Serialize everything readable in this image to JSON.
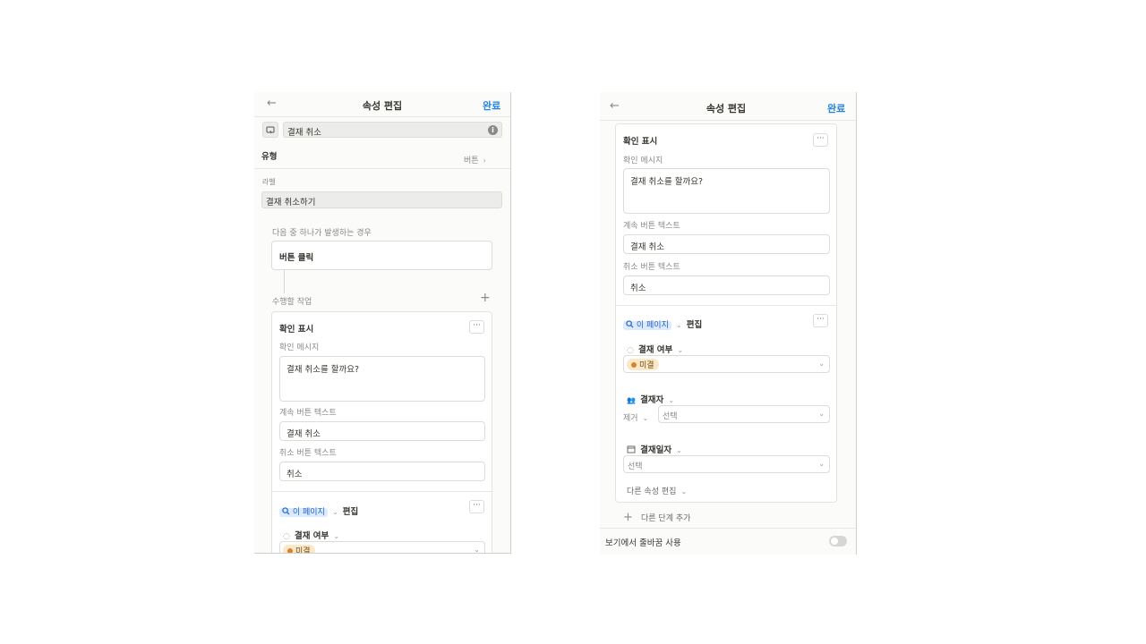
{
  "left": {
    "header": {
      "back_icon": "←",
      "title": "속성 편집",
      "done": "완료"
    },
    "name_field": {
      "value": "결재 취소",
      "info_icon": "i"
    },
    "type_row": {
      "label": "유형",
      "value": "버튼"
    },
    "label_section": {
      "label": "라벨",
      "value": "결재 취소하기"
    },
    "trigger": {
      "heading": "다음 중 하나가 발생하는 경우",
      "value": "버튼 클릭"
    },
    "actions": {
      "heading": "수행할 작업",
      "add_icon": "+"
    },
    "confirm_card": {
      "title": "확인 표시",
      "message_label": "확인 메시지",
      "message_value": "결재 취소를 할까요?",
      "continue_label": "계속 버튼 텍스트",
      "continue_value": "결재 취소",
      "cancel_label": "취소 버튼 텍스트",
      "cancel_value": "취소",
      "more": "···"
    },
    "edit_card": {
      "page_tag": "이 페이지",
      "edit_text": "편집",
      "property": "결재 여부",
      "status_value": "미결",
      "more": "···"
    }
  },
  "right": {
    "header": {
      "back_icon": "←",
      "title": "속성 편집",
      "done": "완료"
    },
    "confirm_card": {
      "title": "확인 표시",
      "message_label": "확인 메시지",
      "message_value": "결재 취소를 할까요?",
      "continue_label": "계속 버튼 텍스트",
      "continue_value": "결재 취소",
      "cancel_label": "취소 버튼 텍스트",
      "cancel_value": "취소",
      "more": "···"
    },
    "edit_card": {
      "page_tag": "이 페이지",
      "edit_text": "편집",
      "more": "···",
      "status_property": "결재 여부",
      "status_value": "미결",
      "person_property": "결재자",
      "person_mode": "제거",
      "person_select": "선택",
      "date_property": "결재일자",
      "date_select": "선택",
      "other_props": "다른 속성 편집"
    },
    "add_step": "다른 단계 추가",
    "wrap_option": {
      "label": "보기에서 줄바꿈 사용",
      "enabled": false
    }
  }
}
